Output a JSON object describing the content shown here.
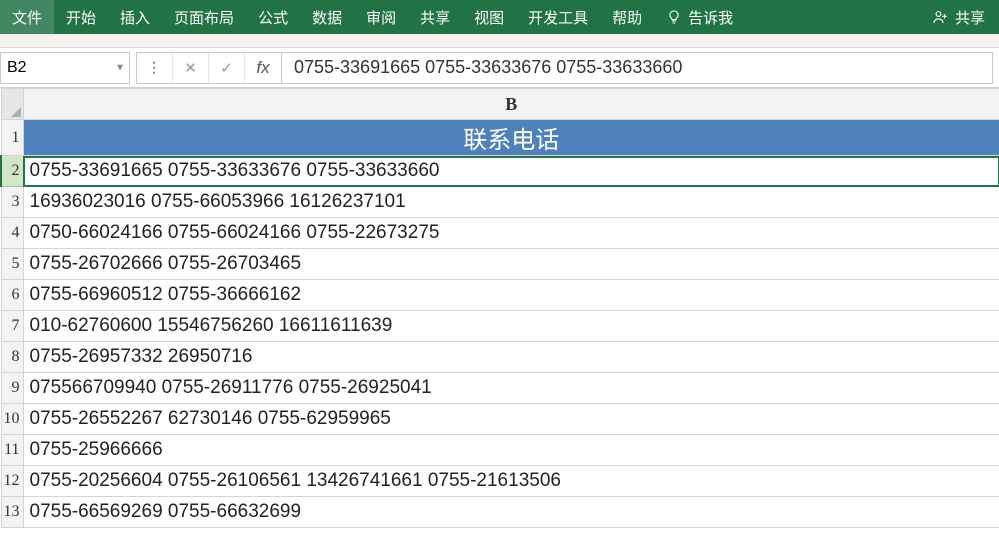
{
  "ribbon": {
    "items": [
      "文件",
      "开始",
      "插入",
      "页面布局",
      "公式",
      "数据",
      "审阅",
      "共享",
      "视图",
      "开发工具",
      "帮助"
    ],
    "tellme": "告诉我",
    "share": "共享"
  },
  "formula_bar": {
    "namebox": "B2",
    "cancel_glyph": "✕",
    "confirm_glyph": "✓",
    "fx_label": "fx",
    "value": "0755-33691665 0755-33633676 0755-33633660"
  },
  "sheet": {
    "column_letter": "B",
    "selected_row": 2,
    "rows": [
      {
        "n": 1,
        "text": "联系电话",
        "is_header": true
      },
      {
        "n": 2,
        "text": "0755-33691665 0755-33633676 0755-33633660",
        "is_header": false
      },
      {
        "n": 3,
        "text": "16936023016 0755-66053966 16126237101",
        "is_header": false
      },
      {
        "n": 4,
        "text": "0750-66024166 0755-66024166 0755-22673275",
        "is_header": false
      },
      {
        "n": 5,
        "text": "0755-26702666 0755-26703465",
        "is_header": false
      },
      {
        "n": 6,
        "text": "0755-66960512 0755-36666162",
        "is_header": false
      },
      {
        "n": 7,
        "text": "010-62760600 15546756260 16611611639",
        "is_header": false
      },
      {
        "n": 8,
        "text": "0755-26957332 26950716",
        "is_header": false
      },
      {
        "n": 9,
        "text": "075566709940 0755-26911776 0755-26925041",
        "is_header": false
      },
      {
        "n": 10,
        "text": "0755-26552267 62730146 0755-62959965",
        "is_header": false
      },
      {
        "n": 11,
        "text": "0755-25966666",
        "is_header": false
      },
      {
        "n": 12,
        "text": "0755-20256604 0755-26106561 13426741661 0755-21613506",
        "is_header": false
      },
      {
        "n": 13,
        "text": "0755-66569269 0755-66632699",
        "is_header": false
      }
    ]
  }
}
